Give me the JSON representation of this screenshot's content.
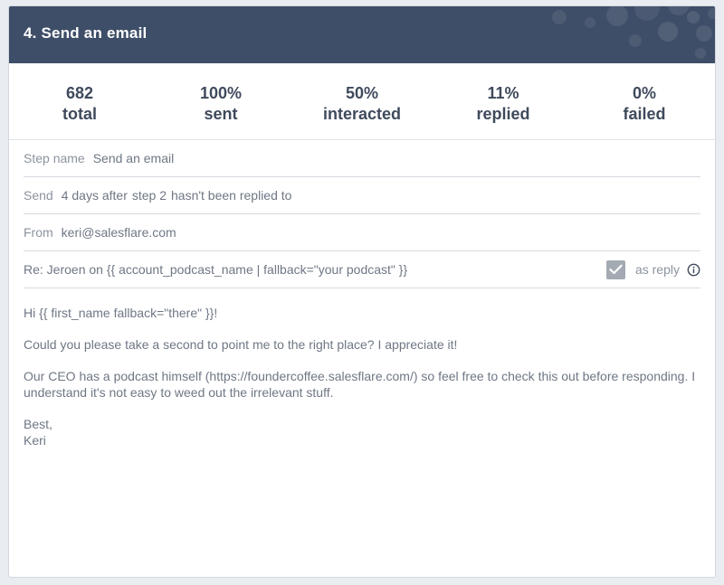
{
  "step": {
    "title": "4. Send an email"
  },
  "stats": [
    {
      "value": "682",
      "label": "total"
    },
    {
      "value": "100%",
      "label": "sent"
    },
    {
      "value": "50%",
      "label": "interacted"
    },
    {
      "value": "11%",
      "label": "replied"
    },
    {
      "value": "0%",
      "label": "failed"
    }
  ],
  "fields": {
    "step_name_label": "Step name",
    "step_name_value": "Send an email",
    "send_label": "Send",
    "send_days": "4 days after",
    "send_step": "step 2",
    "send_condition": "hasn't been replied to",
    "from_label": "From",
    "from_value": "keri@salesflare.com",
    "subject_value": "Re: Jeroen on {{ account_podcast_name | fallback=\"your podcast\" }}",
    "as_reply_label": "as reply",
    "as_reply_checked": true
  },
  "body": {
    "greeting": "Hi {{ first_name fallback=\"there\" }}!",
    "para1": "Could you please take a second to point me to the right place? I appreciate it!",
    "para2": "Our CEO has a podcast himself (https://foundercoffee.salesflare.com/) so feel free to check this out before responding. I understand it's not easy to weed out the irrelevant stuff.",
    "signoff": "Best,",
    "signature": "Keri"
  },
  "colors": {
    "header_bg": "#3e4e68",
    "checkbox_bg": "#a4aab3",
    "text": "#6f7784"
  }
}
